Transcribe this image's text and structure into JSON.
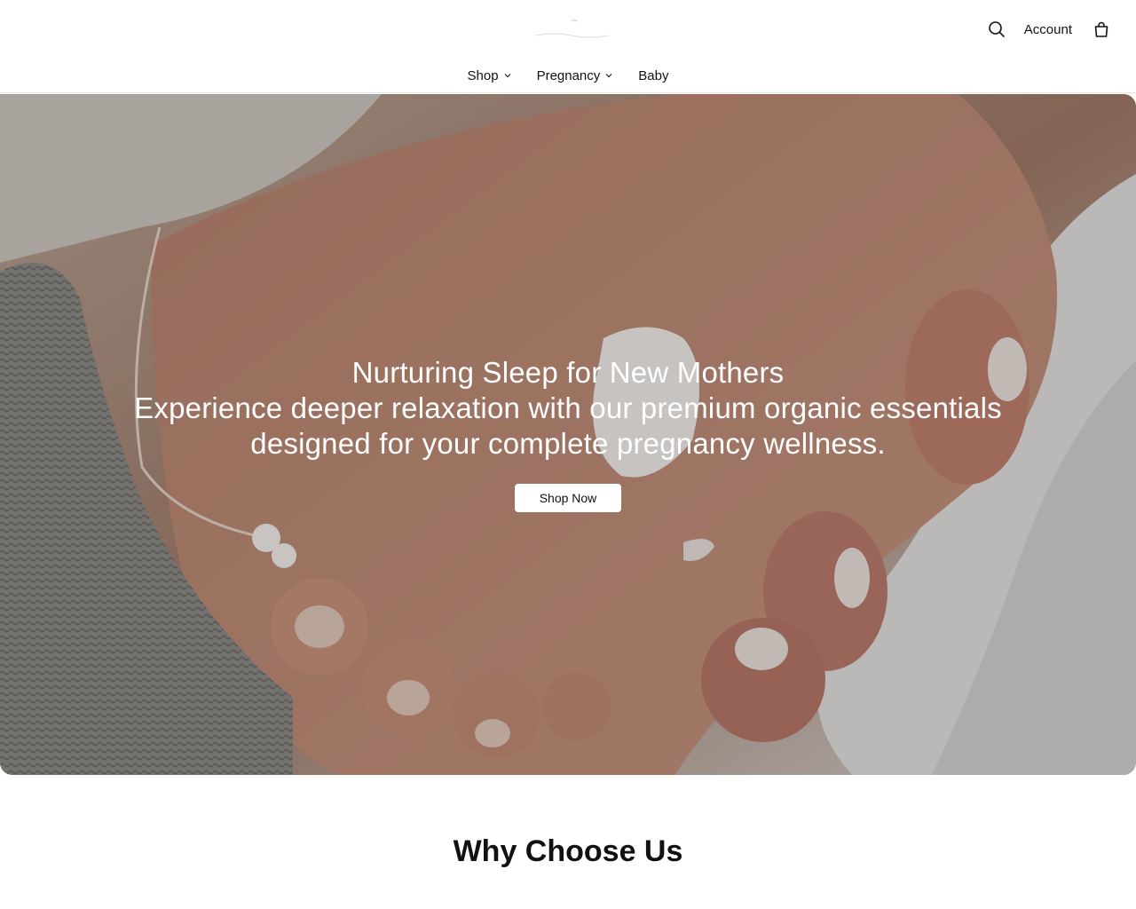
{
  "header": {
    "logo_icon": "brand-logo",
    "account_label": "Account",
    "search_icon": "search-icon",
    "bag_icon": "shopping-bag-icon"
  },
  "nav": {
    "items": [
      {
        "label": "Shop",
        "has_dropdown": true
      },
      {
        "label": "Pregnancy",
        "has_dropdown": true
      },
      {
        "label": "Baby",
        "has_dropdown": false
      }
    ]
  },
  "hero": {
    "title": "Nurturing Sleep for New Mothers",
    "subtitle": "Experience deeper relaxation with our premium organic essentials designed for your complete pregnancy wellness.",
    "cta_label": "Shop Now"
  },
  "section": {
    "heading": "Why Choose Us"
  }
}
